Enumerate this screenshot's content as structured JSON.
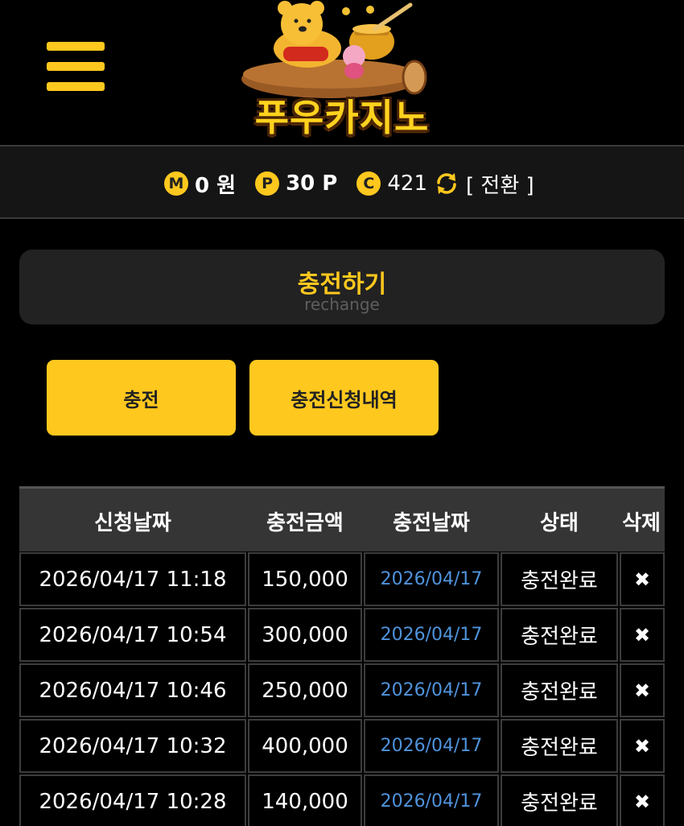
{
  "header": {
    "menu_icon": "hamburger-menu-icon",
    "logo_text": "푸우카지노",
    "accent_color": "#ffc81e"
  },
  "status": {
    "money_badge": "M",
    "money_value": "0 원",
    "point_badge": "P",
    "point_value": "30 P",
    "coin_badge": "C",
    "coin_value": "421",
    "refresh_icon": "refresh-icon",
    "switch_label": "[ 전환 ]"
  },
  "section": {
    "title": "충전하기",
    "subtitle": "rechange"
  },
  "buttons": {
    "charge": "충전",
    "history": "충전신청내역"
  },
  "table": {
    "columns": [
      "신청날짜",
      "충전금액",
      "충전날짜",
      "상태",
      "삭제"
    ],
    "rows": [
      {
        "request_date": "2026/04/17 11:18",
        "amount": "150,000",
        "charge_date": "2026/04/17",
        "status": "충전완료",
        "delete": "✖"
      },
      {
        "request_date": "2026/04/17 10:54",
        "amount": "300,000",
        "charge_date": "2026/04/17",
        "status": "충전완료",
        "delete": "✖"
      },
      {
        "request_date": "2026/04/17 10:46",
        "amount": "250,000",
        "charge_date": "2026/04/17",
        "status": "충전완료",
        "delete": "✖"
      },
      {
        "request_date": "2026/04/17 10:32",
        "amount": "400,000",
        "charge_date": "2026/04/17",
        "status": "충전완료",
        "delete": "✖"
      },
      {
        "request_date": "2026/04/17 10:28",
        "amount": "140,000",
        "charge_date": "2026/04/17",
        "status": "충전완료",
        "delete": "✖"
      }
    ]
  }
}
